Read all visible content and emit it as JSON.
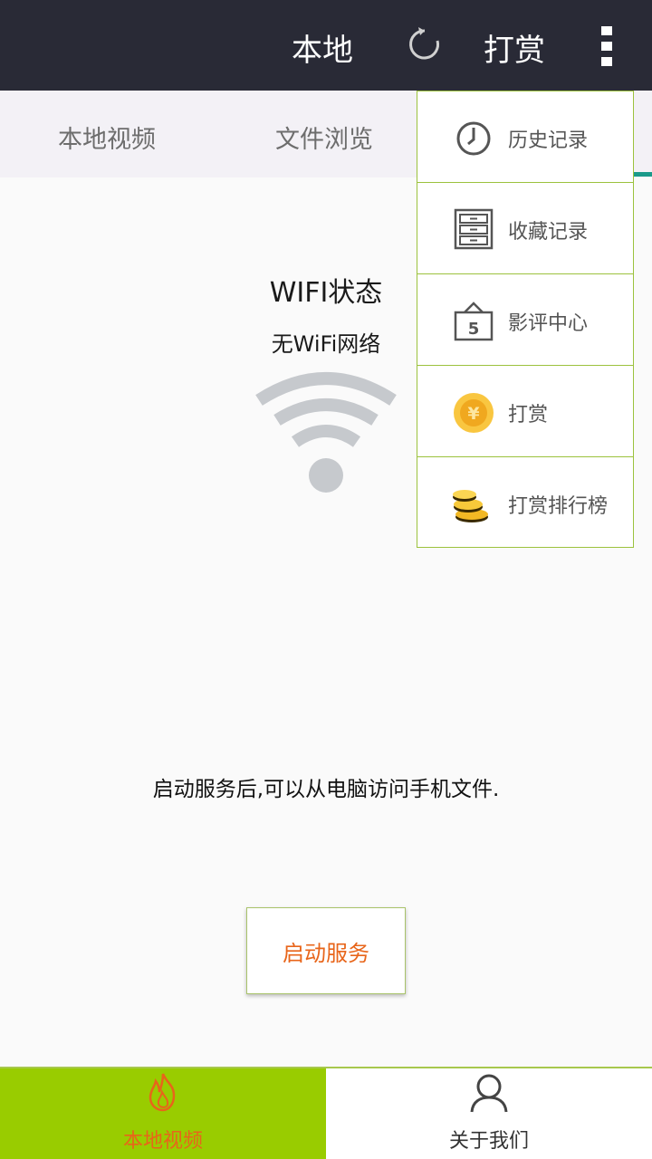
{
  "topbar": {
    "title": "本地",
    "reward_label": "打赏",
    "refresh_icon": "refresh-icon",
    "more_icon": "more-vertical-icon"
  },
  "tabs": [
    {
      "label": "本地视频"
    },
    {
      "label": "文件浏览"
    }
  ],
  "wifi": {
    "title": "WIFI状态",
    "status": "无WiFi网络",
    "icon": "wifi-icon"
  },
  "hint": "启动服务后,可以从电脑访问手机文件.",
  "start_button": "启动服务",
  "bottom_nav": [
    {
      "label": "本地视频",
      "icon": "flame-icon",
      "active": true
    },
    {
      "label": "关于我们",
      "icon": "person-icon",
      "active": false
    }
  ],
  "menu": [
    {
      "label": "历史记录",
      "icon": "clock-icon"
    },
    {
      "label": "收藏记录",
      "icon": "cabinet-icon"
    },
    {
      "label": "影评中心",
      "icon": "calendar-five-icon",
      "badge": "5"
    },
    {
      "label": "打赏",
      "icon": "coin-yuan-icon",
      "glyph": "¥"
    },
    {
      "label": "打赏排行榜",
      "icon": "coin-stack-icon"
    }
  ],
  "colors": {
    "topbar": "#292a36",
    "accent_green": "#99cc00",
    "accent_orange": "#e8651a",
    "menu_border": "#9cc23d",
    "tab_indicator": "#1a9a8a"
  }
}
